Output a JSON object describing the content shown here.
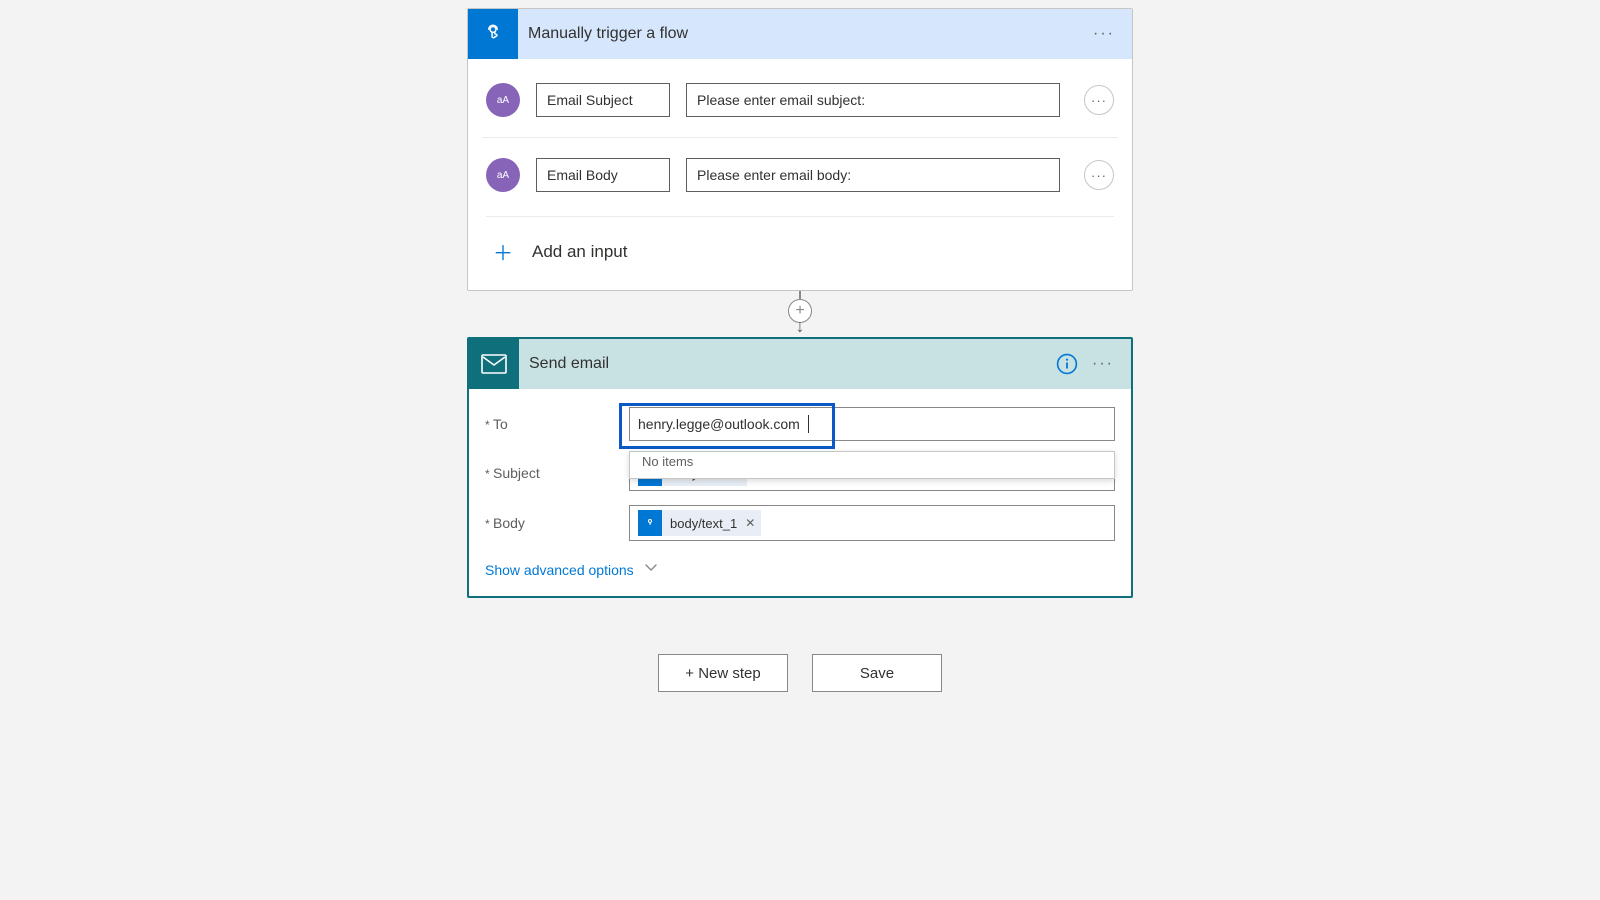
{
  "trigger": {
    "title": "Manually trigger a flow",
    "badgeText": "aA",
    "inputs": [
      {
        "name": "Email Subject",
        "placeholder": "Please enter email subject:"
      },
      {
        "name": "Email Body",
        "placeholder": "Please enter email body:"
      }
    ],
    "addInputLabel": "Add an input"
  },
  "action": {
    "title": "Send email",
    "fields": {
      "to": {
        "label": "To",
        "value": "henry.legge@outlook.com"
      },
      "subject": {
        "label": "Subject",
        "token": "body/text"
      },
      "body": {
        "label": "Body",
        "token": "body/text_1"
      }
    },
    "autocompleteLabel": "No items"
  },
  "advancedLabel": "Show advanced options",
  "footer": {
    "newStep": "+ New step",
    "save": "Save"
  }
}
